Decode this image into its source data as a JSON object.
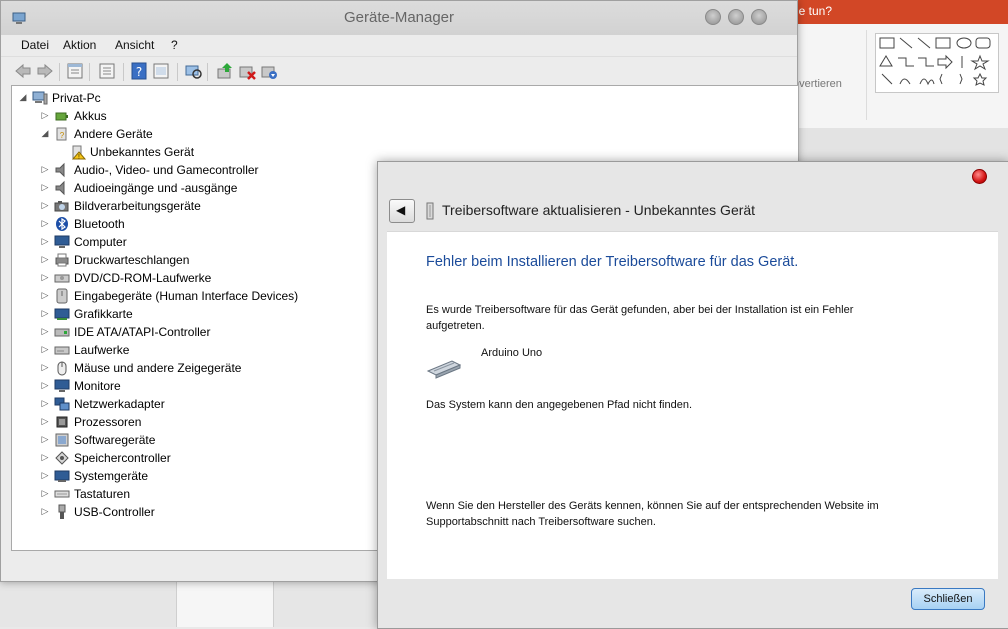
{
  "background_app": {
    "ribbon_top_text": "ie tun?",
    "ribbon_text": "nvertieren",
    "accent_color": "#d24726"
  },
  "device_manager": {
    "title": "Geräte-Manager",
    "menu": [
      "Datei",
      "Aktion",
      "Ansicht",
      "?"
    ],
    "toolbar_icons": [
      "back-icon",
      "forward-icon",
      "properties-icon",
      "view-icon",
      "help-icon",
      "console-icon",
      "scan-hardware-icon",
      "update-driver-icon",
      "uninstall-icon",
      "disable-icon"
    ],
    "tree": {
      "root": "Privat-Pc",
      "items": [
        {
          "label": "Akkus",
          "icon": "battery-icon",
          "expander": "▷"
        },
        {
          "label": "Andere Geräte",
          "icon": "other-devices-icon",
          "expander": "◢"
        },
        {
          "label": "Unbekanntes Gerät",
          "icon": "warning-device-icon",
          "expander": ""
        },
        {
          "label": "Audio-, Video- und Gamecontroller",
          "icon": "speaker-icon",
          "expander": "▷"
        },
        {
          "label": "Audioeingänge und -ausgänge",
          "icon": "speaker-icon",
          "expander": "▷"
        },
        {
          "label": "Bildverarbeitungsgeräte",
          "icon": "camera-icon",
          "expander": "▷"
        },
        {
          "label": "Bluetooth",
          "icon": "bluetooth-icon",
          "expander": "▷"
        },
        {
          "label": "Computer",
          "icon": "monitor-icon",
          "expander": "▷"
        },
        {
          "label": "Druckwarteschlangen",
          "icon": "printer-icon",
          "expander": "▷"
        },
        {
          "label": "DVD/CD-ROM-Laufwerke",
          "icon": "disc-drive-icon",
          "expander": "▷"
        },
        {
          "label": "Eingabegeräte (Human Interface Devices)",
          "icon": "hid-icon",
          "expander": "▷"
        },
        {
          "label": "Grafikkarte",
          "icon": "display-adapter-icon",
          "expander": "▷"
        },
        {
          "label": "IDE ATA/ATAPI-Controller",
          "icon": "ide-controller-icon",
          "expander": "▷"
        },
        {
          "label": "Laufwerke",
          "icon": "disk-drive-icon",
          "expander": "▷"
        },
        {
          "label": "Mäuse und andere Zeigegeräte",
          "icon": "mouse-icon",
          "expander": "▷"
        },
        {
          "label": "Monitore",
          "icon": "monitor-icon",
          "expander": "▷"
        },
        {
          "label": "Netzwerkadapter",
          "icon": "network-icon",
          "expander": "▷"
        },
        {
          "label": "Prozessoren",
          "icon": "processor-icon",
          "expander": "▷"
        },
        {
          "label": "Softwaregeräte",
          "icon": "software-device-icon",
          "expander": "▷"
        },
        {
          "label": "Speichercontroller",
          "icon": "storage-controller-icon",
          "expander": "▷"
        },
        {
          "label": "Systemgeräte",
          "icon": "system-device-icon",
          "expander": "▷"
        },
        {
          "label": "Tastaturen",
          "icon": "keyboard-icon",
          "expander": "▷"
        },
        {
          "label": "USB-Controller",
          "icon": "usb-icon",
          "expander": "▷"
        }
      ]
    }
  },
  "dialog": {
    "heading": "Treibersoftware aktualisieren - Unbekanntes Gerät",
    "error_title": "Fehler beim Installieren der Treibersoftware für das Gerät.",
    "message_line1": "Es wurde Treibersoftware für das Gerät gefunden, aber bei der Installation ist ein Fehler",
    "message_line2": "aufgetreten.",
    "device_name": "Arduino Uno",
    "path_error": "Das System kann den angegebenen Pfad nicht finden.",
    "hint_line1": "Wenn Sie den Hersteller des Geräts kennen, können Sie auf der entsprechenden Website im",
    "hint_line2": "Supportabschnitt nach Treibersoftware suchen.",
    "close_button": "Schließen",
    "back_glyph": "◀"
  }
}
